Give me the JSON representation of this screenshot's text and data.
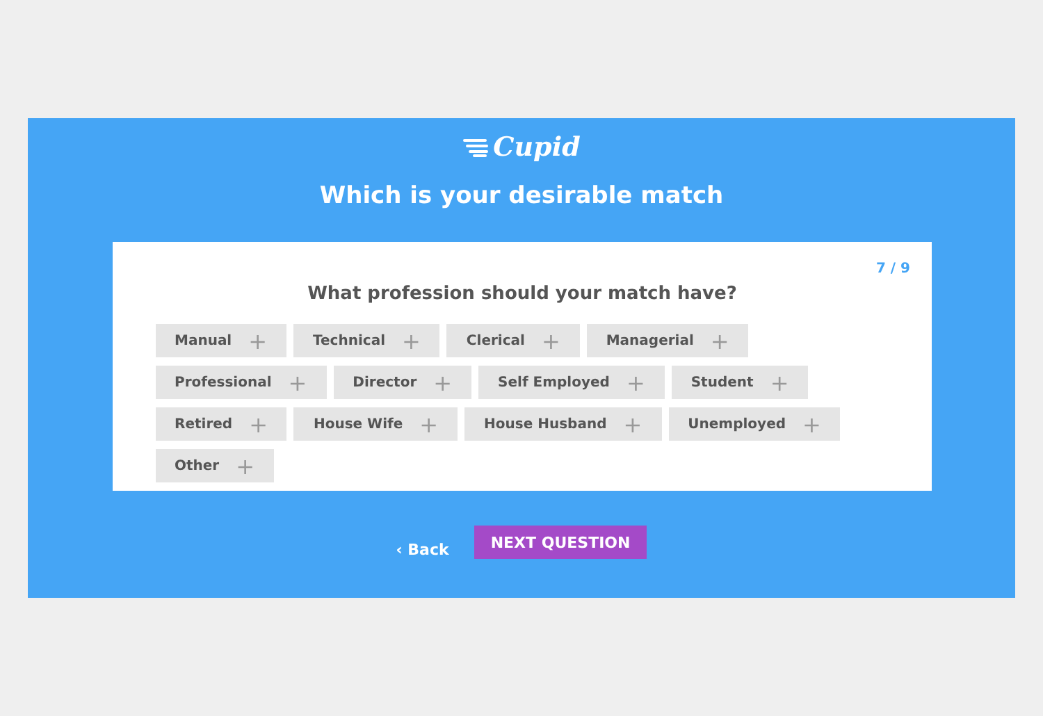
{
  "logo": {
    "text": "Cupid"
  },
  "heading": "Which is your desirable match",
  "card": {
    "progress": "7 / 9",
    "question": "What profession should your match have?",
    "options": [
      {
        "label": "Manual",
        "add": "+"
      },
      {
        "label": "Technical",
        "add": "+"
      },
      {
        "label": "Clerical",
        "add": "+"
      },
      {
        "label": "Managerial",
        "add": "+"
      },
      {
        "label": "Professional",
        "add": "+"
      },
      {
        "label": "Director",
        "add": "+"
      },
      {
        "label": "Self Employed",
        "add": "+"
      },
      {
        "label": "Student",
        "add": "+"
      },
      {
        "label": "Retired",
        "add": "+"
      },
      {
        "label": "House Wife",
        "add": "+"
      },
      {
        "label": "House Husband",
        "add": "+"
      },
      {
        "label": "Unemployed",
        "add": "+"
      },
      {
        "label": "Other",
        "add": "+"
      }
    ]
  },
  "back": {
    "arrow": "‹",
    "label": "Back"
  },
  "next": "NEXT QUESTION"
}
